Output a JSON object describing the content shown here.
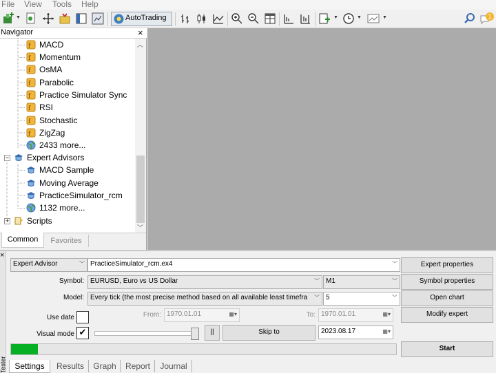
{
  "menu": [
    "File",
    "View",
    "Tools",
    "Help"
  ],
  "toolbar": {
    "autotrading_label": "AutoTrading",
    "notification_count": "1"
  },
  "navigator": {
    "title": "Navigator",
    "items": [
      {
        "label": "MACD",
        "icon": "indicator-icon"
      },
      {
        "label": "Momentum",
        "icon": "indicator-icon"
      },
      {
        "label": "OsMA",
        "icon": "indicator-icon"
      },
      {
        "label": "Parabolic",
        "icon": "indicator-icon"
      },
      {
        "label": "Practice Simulator Sync",
        "icon": "indicator-icon"
      },
      {
        "label": "RSI",
        "icon": "indicator-icon"
      },
      {
        "label": "Stochastic",
        "icon": "indicator-icon"
      },
      {
        "label": "ZigZag",
        "icon": "indicator-icon"
      },
      {
        "label": "2433 more...",
        "icon": "globe-icon"
      },
      {
        "label": "Expert Advisors",
        "icon": "experts-folder-icon"
      },
      {
        "label": "MACD Sample",
        "icon": "expert-icon"
      },
      {
        "label": "Moving Average",
        "icon": "expert-icon"
      },
      {
        "label": "PracticeSimulator_rcm",
        "icon": "expert-icon"
      },
      {
        "label": "1132 more...",
        "icon": "globe-icon"
      },
      {
        "label": "Scripts",
        "icon": "scripts-folder-icon"
      }
    ],
    "tabs": [
      "Common",
      "Favorites"
    ]
  },
  "tester": {
    "side_label": "Tester",
    "type": "Expert Advisor",
    "expert_file": "PracticeSimulator_rcm.ex4",
    "symbol_label": "Symbol:",
    "symbol_value": "EURUSD, Euro vs US Dollar",
    "period": "M1",
    "model_label": "Model:",
    "model_value": "Every tick (the most precise method based on all available least timefra",
    "spread": "5",
    "use_date_label": "Use date",
    "from_label": "From:",
    "from_value": "1970.01.01",
    "to_label": "To:",
    "to_value": "1970.01.01",
    "visual_mode_label": "Visual mode",
    "pause_label": "||",
    "skip_to_label": "Skip to",
    "skip_date": "2023.08.17",
    "buttons": {
      "expert_properties": "Expert properties",
      "symbol_properties": "Symbol properties",
      "open_chart": "Open chart",
      "modify_expert": "Modify expert",
      "start": "Start"
    },
    "progress": 0.07,
    "visual_speed": 1.0,
    "tabs": [
      "Settings",
      "Results",
      "Graph",
      "Report",
      "Journal"
    ]
  }
}
